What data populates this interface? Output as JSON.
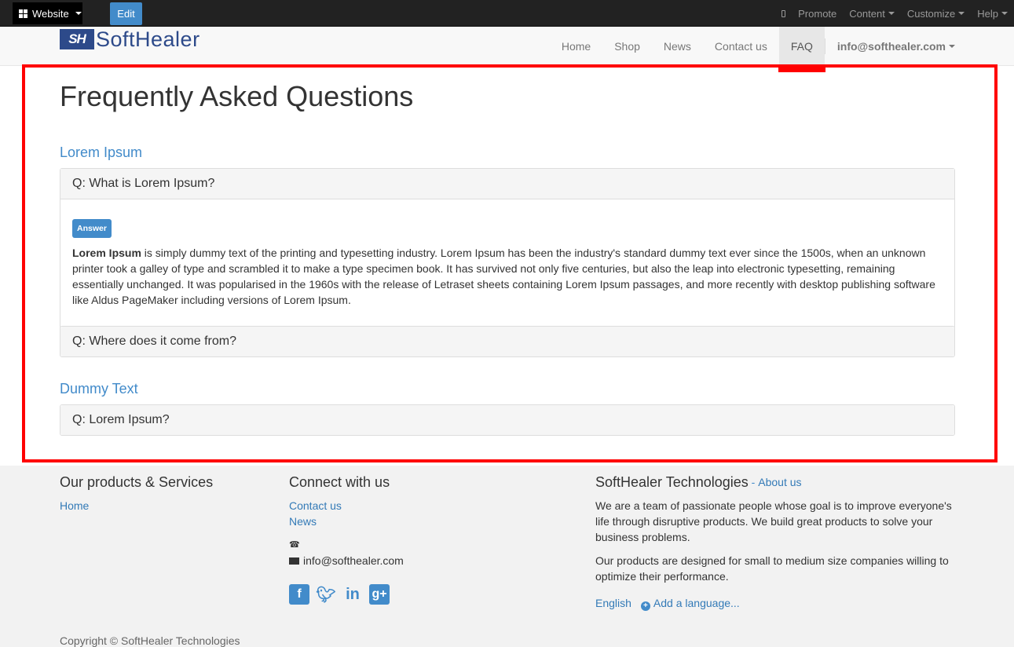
{
  "adminbar": {
    "website_label": "Website",
    "edit_label": "Edit",
    "promote_label": "Promote",
    "content_label": "Content",
    "customize_label": "Customize",
    "help_label": "Help"
  },
  "header": {
    "logo_mark": "SH",
    "logo_text": "SoftHealer",
    "nav": [
      "Home",
      "Shop",
      "News",
      "Contact us",
      "FAQ"
    ],
    "user": "info@softhealer.com"
  },
  "main": {
    "title": "Frequently Asked Questions",
    "sections": [
      {
        "title": "Lorem Ipsum",
        "questions": [
          {
            "q": "Q: What is Lorem Ipsum?",
            "badge": "Answer",
            "answer_bold": "Lorem Ipsum",
            "answer_rest": " is simply dummy text of the printing and typesetting industry. Lorem Ipsum has been the industry's standard dummy text ever since the 1500s, when an unknown printer took a galley of type and scrambled it to make a type specimen book. It has survived not only five centuries, but also the leap into electronic typesetting, remaining essentially unchanged. It was popularised in the 1960s with the release of Letraset sheets containing Lorem Ipsum passages, and more recently with desktop publishing software like Aldus PageMaker including versions of Lorem Ipsum."
          },
          {
            "q": "Q: Where does it come from?"
          }
        ]
      },
      {
        "title": "Dummy Text",
        "questions": [
          {
            "q": "Q: Lorem Ipsum?"
          }
        ]
      }
    ]
  },
  "footer": {
    "products_title": "Our products & Services",
    "products_links": [
      "Home"
    ],
    "connect_title": "Connect with us",
    "connect_links": [
      "Contact us",
      "News"
    ],
    "email": "info@softhealer.com",
    "company_title": "SoftHealer Technologies",
    "about_link": "About us",
    "about_sep": " - ",
    "about_p1": "We are a team of passionate people whose goal is to improve everyone's life through disruptive products. We build great products to solve your business problems.",
    "about_p2": "Our products are designed for small to medium size companies willing to optimize their performance.",
    "language": "English",
    "add_language": "Add a language...",
    "copyright": "Copyright © SoftHealer Technologies"
  },
  "colors": {
    "accent": "#428bca",
    "highlight": "#ff0000",
    "adminbar": "#222222"
  }
}
